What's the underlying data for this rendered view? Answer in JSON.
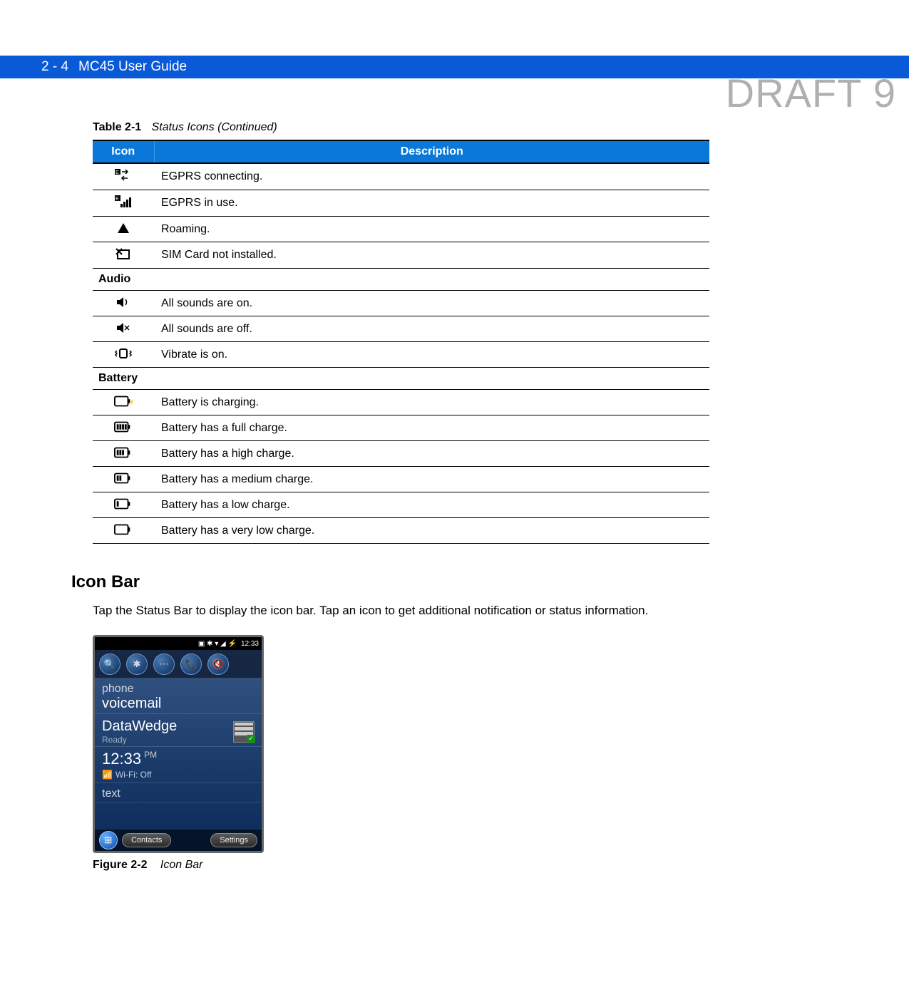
{
  "watermark": "DRAFT 9",
  "header": {
    "page_num": "2 - 4",
    "title": "MC45 User Guide"
  },
  "table": {
    "caption_label": "Table 2-1",
    "caption_title": "Status Icons (Continued)",
    "head_icon": "Icon",
    "head_desc": "Description",
    "rows": [
      {
        "type": "icon",
        "icon": "egprs-connecting-icon",
        "desc": "EGPRS connecting."
      },
      {
        "type": "icon",
        "icon": "egprs-in-use-icon",
        "desc": "EGPRS in use."
      },
      {
        "type": "icon",
        "icon": "roaming-icon",
        "desc": "Roaming."
      },
      {
        "type": "icon",
        "icon": "no-sim-icon",
        "desc": "SIM Card not installed."
      },
      {
        "type": "section",
        "desc": "Audio"
      },
      {
        "type": "icon",
        "icon": "sound-on-icon",
        "desc": "All sounds are on."
      },
      {
        "type": "icon",
        "icon": "sound-off-icon",
        "desc": "All sounds are off."
      },
      {
        "type": "icon",
        "icon": "vibrate-icon",
        "desc": "Vibrate is on."
      },
      {
        "type": "section",
        "desc": "Battery"
      },
      {
        "type": "icon",
        "icon": "battery-charging-icon",
        "desc": "Battery is charging."
      },
      {
        "type": "icon",
        "icon": "battery-full-icon",
        "desc": "Battery has a full charge."
      },
      {
        "type": "icon",
        "icon": "battery-high-icon",
        "desc": "Battery has a high charge."
      },
      {
        "type": "icon",
        "icon": "battery-medium-icon",
        "desc": "Battery has a medium charge."
      },
      {
        "type": "icon",
        "icon": "battery-low-icon",
        "desc": "Battery has a low charge."
      },
      {
        "type": "icon",
        "icon": "battery-very-low-icon",
        "desc": "Battery has a very low charge."
      }
    ]
  },
  "section_heading": "Icon Bar",
  "body_text": "Tap the Status Bar to display the icon bar. Tap an icon to get additional notification or status information.",
  "phone": {
    "status_time": "12:33",
    "iconbar_icons": [
      "🔍",
      "✱",
      "⋯",
      "📞",
      "🔇"
    ],
    "item1_sub": "phone",
    "item1_main": "voicemail",
    "item2_main": "DataWedge",
    "item2_sub": "Ready",
    "clock_time": "12:33",
    "clock_ampm": "PM",
    "wifi_label": "Wi-Fi: Off",
    "item3": "text",
    "bottom_contacts": "Contacts",
    "bottom_settings": "Settings"
  },
  "figure": {
    "label": "Figure 2-2",
    "title": "Icon Bar"
  }
}
